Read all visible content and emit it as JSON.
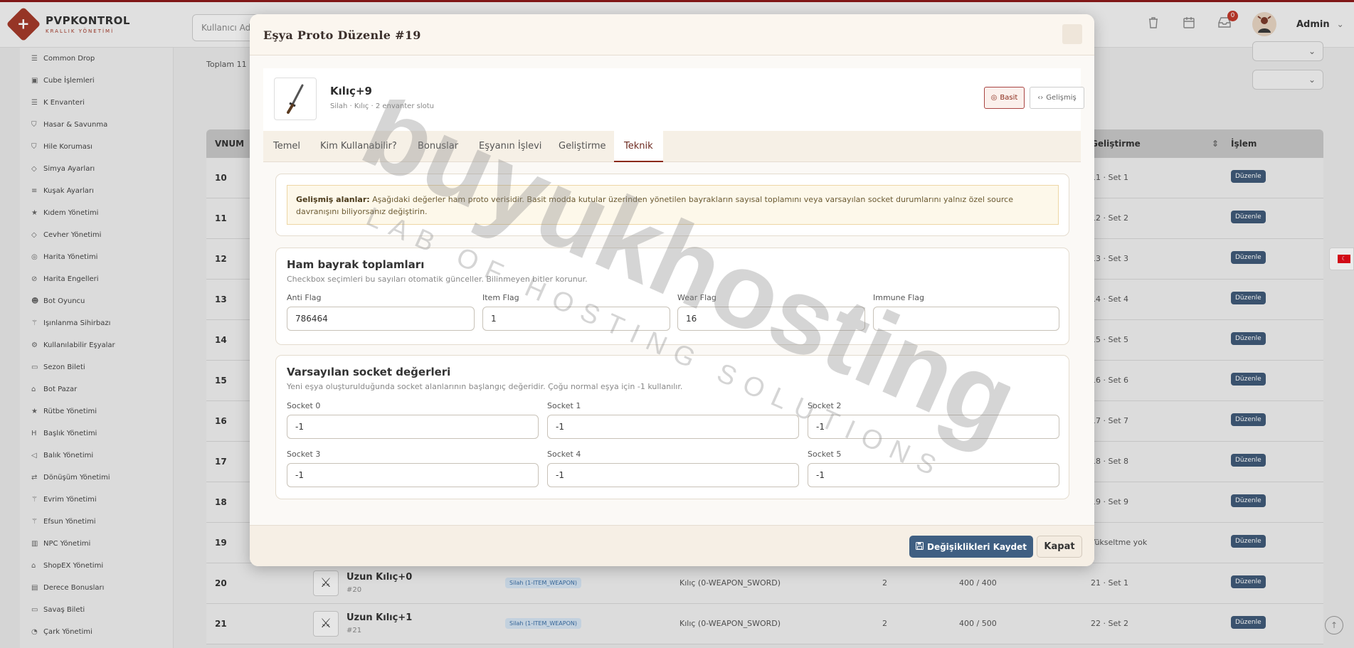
{
  "brand": {
    "name": "PVPKONTROL",
    "subtitle": "KRALLIK YÖNETİMİ",
    "logo_icon": "plus-diamond-icon"
  },
  "topbar": {
    "search_placeholder": "Kullanıcı Adı",
    "notif_count": "0",
    "user_name": "Admin"
  },
  "sidebar": {
    "items": [
      {
        "label": "Common Drop",
        "icon": "list-icon"
      },
      {
        "label": "Cube İşlemleri",
        "icon": "cube-icon"
      },
      {
        "label": "K Envanteri",
        "icon": "list-icon"
      },
      {
        "label": "Hasar & Savunma",
        "icon": "shield-icon"
      },
      {
        "label": "Hile Koruması",
        "icon": "shield-icon"
      },
      {
        "label": "Simya Ayarları",
        "icon": "gem-icon"
      },
      {
        "label": "Kuşak Ayarları",
        "icon": "sliders-icon"
      },
      {
        "label": "Kıdem Yönetimi",
        "icon": "star-icon"
      },
      {
        "label": "Cevher Yönetimi",
        "icon": "gem-icon"
      },
      {
        "label": "Harita Yönetimi",
        "icon": "globe-icon"
      },
      {
        "label": "Harita Engelleri",
        "icon": "ban-icon"
      },
      {
        "label": "Bot Oyuncu",
        "icon": "robot-icon"
      },
      {
        "label": "Işınlanma Sihirbazı",
        "icon": "wand-icon"
      },
      {
        "label": "Kullanılabilir Eşyalar",
        "icon": "cogs-icon"
      },
      {
        "label": "Sezon Bileti",
        "icon": "ticket-icon"
      },
      {
        "label": "Bot Pazar",
        "icon": "store-icon"
      },
      {
        "label": "Rütbe Yönetimi",
        "icon": "star-icon"
      },
      {
        "label": "Başlık Yönetimi",
        "icon": "heading-icon"
      },
      {
        "label": "Balık Yönetimi",
        "icon": "fish-icon"
      },
      {
        "label": "Dönüşüm Yönetimi",
        "icon": "shuffle-icon"
      },
      {
        "label": "Evrim Yönetimi",
        "icon": "wand-icon"
      },
      {
        "label": "Efsun Yönetimi",
        "icon": "wand-icon"
      },
      {
        "label": "NPC Yönetimi",
        "icon": "building-icon"
      },
      {
        "label": "ShopEX Yönetimi",
        "icon": "store-icon"
      },
      {
        "label": "Derece Bonusları",
        "icon": "chart-icon"
      },
      {
        "label": "Savaş Bileti",
        "icon": "ticket-icon"
      },
      {
        "label": "Çark Yönetimi",
        "icon": "wheel-icon"
      }
    ]
  },
  "content": {
    "total_text": "Toplam 11",
    "table_headers": {
      "vnum": "VNUM",
      "gelistirme": "Geliştirme",
      "islem": "İşlem"
    },
    "rows": [
      {
        "vnum": "10",
        "set": "11 · Set 1",
        "action": "Düzenle"
      },
      {
        "vnum": "11",
        "set": "12 · Set 2",
        "action": "Düzenle"
      },
      {
        "vnum": "12",
        "set": "13 · Set 3",
        "action": "Düzenle"
      },
      {
        "vnum": "13",
        "set": "14 · Set 4",
        "action": "Düzenle"
      },
      {
        "vnum": "14",
        "set": "15 · Set 5",
        "action": "Düzenle"
      },
      {
        "vnum": "15",
        "set": "16 · Set 6",
        "action": "Düzenle"
      },
      {
        "vnum": "16",
        "set": "17 · Set 7",
        "action": "Düzenle"
      },
      {
        "vnum": "17",
        "set": "18 · Set 8",
        "action": "Düzenle"
      },
      {
        "vnum": "18",
        "set": "19 · Set 9",
        "action": "Düzenle"
      },
      {
        "vnum": "19",
        "set": "Yükseltme yok",
        "action": "Düzenle"
      },
      {
        "vnum": "20",
        "name": "Uzun Kılıç+0",
        "sub": "#20",
        "tag": "Silah (1-ITEM_WEAPON)",
        "kind": "Kılıç (0-WEAPON_SWORD)",
        "n": "2",
        "hp": "400 / 400",
        "set": "21 · Set 1",
        "action": "Düzenle"
      },
      {
        "vnum": "21",
        "name": "Uzun Kılıç+1",
        "sub": "#21",
        "tag": "Silah (1-ITEM_WEAPON)",
        "kind": "Kılıç (0-WEAPON_SWORD)",
        "n": "2",
        "hp": "400 / 500",
        "set": "22 · Set 2",
        "action": "Düzenle"
      }
    ]
  },
  "modal": {
    "title": "Eşya Proto Düzenle #19",
    "item": {
      "name": "Kılıç+9",
      "subtitle": "Silah · Kılıç · 2 envanter slotu",
      "icon": "sword-icon"
    },
    "mode_buttons": {
      "basic": "Basit",
      "advanced": "Gelişmiş"
    },
    "tabs": [
      "Temel",
      "Kim Kullanabilir?",
      "Bonuslar",
      "Eşyanın İşlevi",
      "Geliştirme",
      "Teknik"
    ],
    "active_tab": "Teknik",
    "warning": {
      "strong": "Gelişmiş alanlar:",
      "text": " Aşağıdaki değerler ham proto verisidir. Basit modda kutular üzerinden yönetilen bayrakların sayısal toplamını veya varsayılan socket durumlarını yalnız özel source davranışını biliyorsanız değiştirin."
    },
    "flags": {
      "title": "Ham bayrak toplamları",
      "description": "Checkbox seçimleri bu sayıları otomatik günceller. Bilinmeyen bitler korunur.",
      "fields": [
        {
          "label": "Anti Flag",
          "value": "786464"
        },
        {
          "label": "Item Flag",
          "value": "1"
        },
        {
          "label": "Wear Flag",
          "value": "16"
        },
        {
          "label": "Immune Flag",
          "value": ""
        }
      ]
    },
    "sockets": {
      "title": "Varsayılan socket değerleri",
      "description": "Yeni eşya oluşturulduğunda socket alanlarının başlangıç değeridir. Çoğu normal eşya için -1 kullanılır.",
      "fields": [
        {
          "label": "Socket 0",
          "value": "-1"
        },
        {
          "label": "Socket 1",
          "value": "-1"
        },
        {
          "label": "Socket 2",
          "value": "-1"
        },
        {
          "label": "Socket 3",
          "value": "-1"
        },
        {
          "label": "Socket 4",
          "value": "-1"
        },
        {
          "label": "Socket 5",
          "value": "-1"
        }
      ]
    },
    "footer": {
      "save_label": "Değişiklikleri Kaydet",
      "close_label": "Kapat"
    }
  },
  "watermark": {
    "main": "buyukhosting",
    "sub": "LAB OF HOSTING SOLUTIONS"
  },
  "colors": {
    "brand_red": "#8b1a1a",
    "primary_blue": "#3f5f82",
    "warning_bg": "#fdf8ea"
  }
}
